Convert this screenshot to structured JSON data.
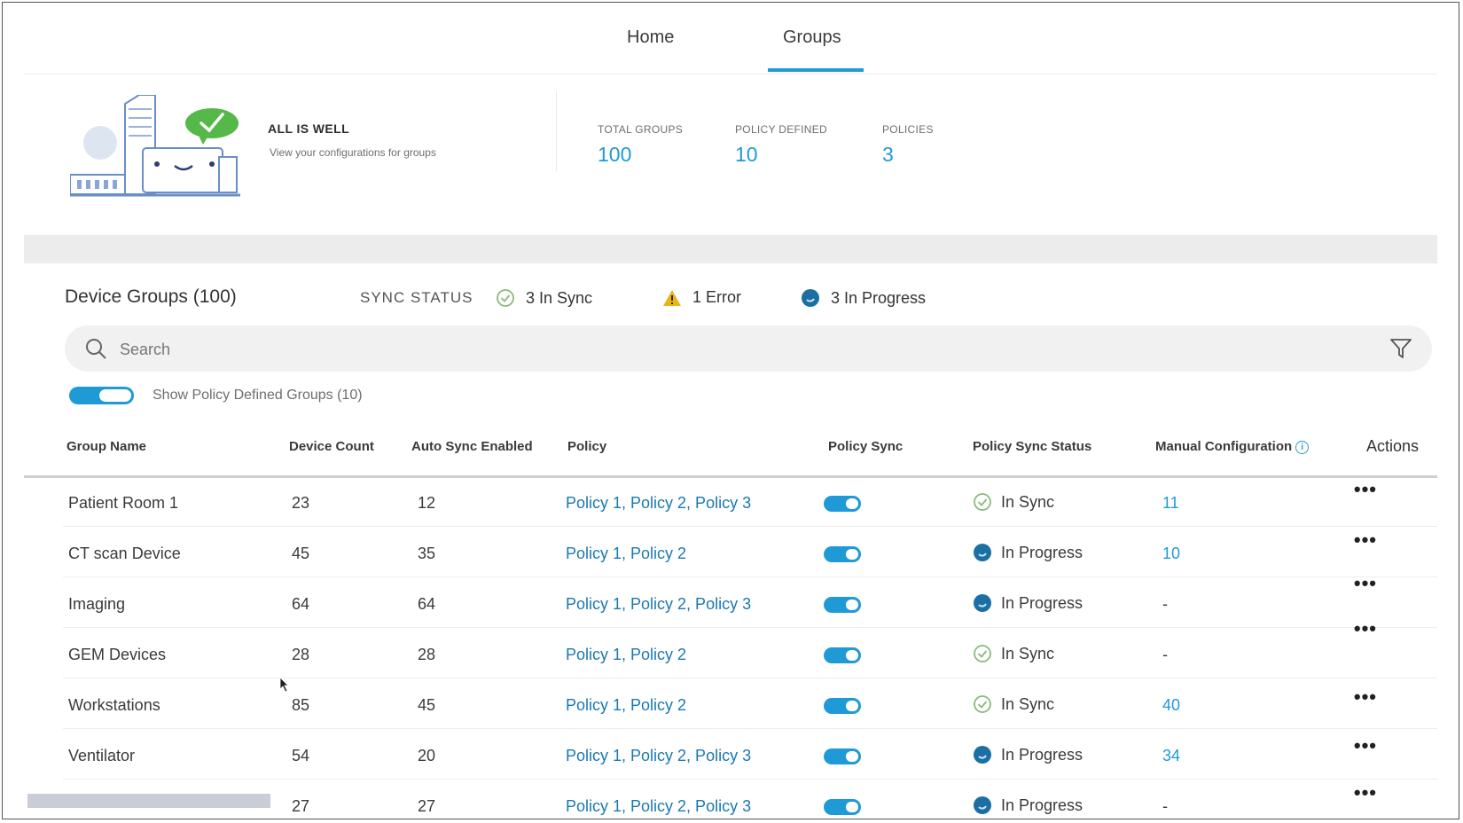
{
  "nav": {
    "tabs": [
      {
        "label": "Home"
      },
      {
        "label": "Groups"
      }
    ]
  },
  "banner": {
    "title": "ALL IS WELL",
    "subtitle": "View your configurations for groups",
    "stats": [
      {
        "label": "TOTAL GROUPS",
        "value": "100"
      },
      {
        "label": "POLICY DEFINED",
        "value": "10"
      },
      {
        "label": "POLICIES",
        "value": "3"
      }
    ]
  },
  "groups": {
    "title": "Device Groups (100)",
    "sync_label": "SYNC STATUS",
    "sync_in_sync": "3 In Sync",
    "sync_error": "1 Error",
    "sync_progress": "3 In Progress"
  },
  "search": {
    "placeholder": "Search"
  },
  "toggle_label": "Show Policy Defined Groups (10)",
  "table": {
    "headers": [
      "Group Name",
      "Device Count",
      "Auto Sync Enabled",
      "Policy",
      "Policy Sync",
      "Policy Sync Status",
      "Manual Configuration",
      "Actions"
    ],
    "info_icon": "i",
    "actions_label": "•••",
    "rows": [
      {
        "name": "Patient  Room 1",
        "count": "23",
        "auto": "12",
        "policy": "Policy 1, Policy 2, Policy 3",
        "status": "In Sync",
        "manual": "11"
      },
      {
        "name": "CT scan Device",
        "count": "45",
        "auto": "35",
        "policy": "Policy 1, Policy 2",
        "status": "In Progress",
        "manual": "10"
      },
      {
        "name": "Imaging",
        "count": "64",
        "auto": "64",
        "policy": "Policy 1, Policy 2, Policy 3",
        "status": "In Progress",
        "manual": "-"
      },
      {
        "name": "GEM Devices",
        "count": "28",
        "auto": "28",
        "policy": "Policy 1, Policy 2",
        "status": "In Sync",
        "manual": "-"
      },
      {
        "name": "Workstations",
        "count": "85",
        "auto": "45",
        "policy": "Policy 1, Policy 2",
        "status": "In Sync",
        "manual": "40"
      },
      {
        "name": "Ventilator",
        "count": "54",
        "auto": "20",
        "policy": "Policy 1, Policy 2, Policy 3",
        "status": "In Progress",
        "manual": "34"
      },
      {
        "name": "",
        "count": "27",
        "auto": "27",
        "policy": "Policy 1, Policy 2, Policy 3",
        "status": "In Progress",
        "manual": "-"
      }
    ]
  },
  "colors": {
    "accent": "#1f9ad6",
    "link": "#1a78b3",
    "sync_green": "#8bb97d",
    "progress_blue": "#1b6fa3",
    "warning": "#e8b419"
  },
  "icons": {
    "in_sync": "check-circle-icon",
    "error": "warning-icon",
    "progress": "progress-icon",
    "search": "search-icon",
    "filter": "filter-icon"
  }
}
